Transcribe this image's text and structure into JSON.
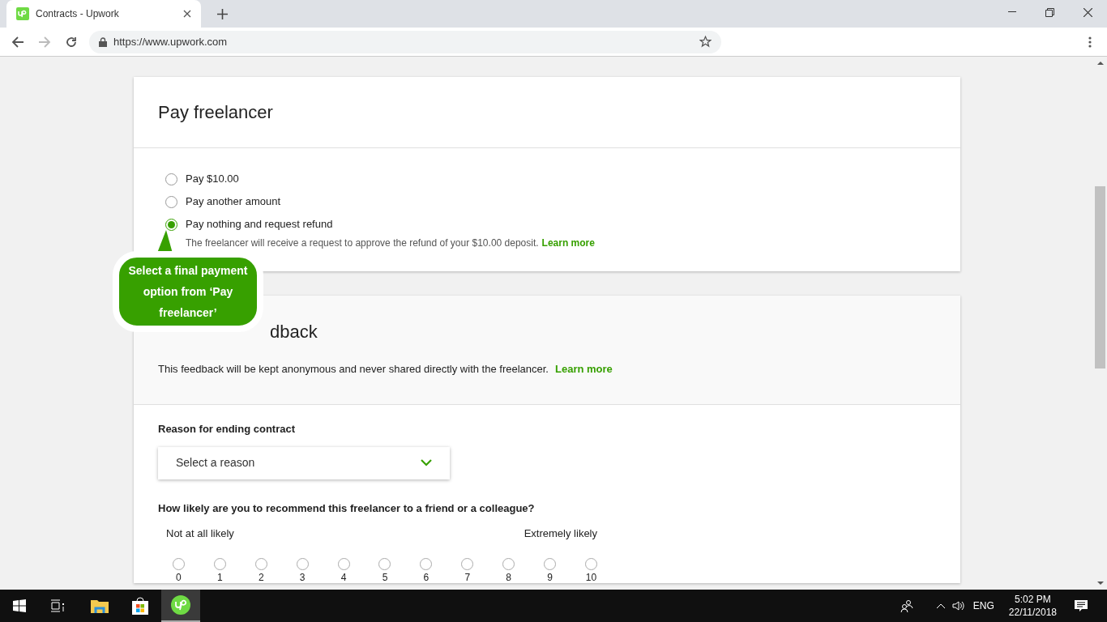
{
  "browser": {
    "tab_title": "Contracts - Upwork",
    "url": "https://www.upwork.com"
  },
  "pay_card": {
    "title": "Pay freelancer",
    "options": [
      {
        "label": "Pay $10.00",
        "selected": false
      },
      {
        "label": "Pay another amount",
        "selected": false
      },
      {
        "label": "Pay nothing and request refund",
        "selected": true
      }
    ],
    "note": "The freelancer will receive a request to approve the refund of your $10.00 deposit.",
    "note_link": "Learn more"
  },
  "tooltip": "Select a final payment option from ‘Pay freelancer’",
  "feedback_card": {
    "title": "dback",
    "intro": "This feedback will be kept anonymous and never shared directly with the freelancer.",
    "intro_link": "Learn more",
    "reason_label": "Reason for ending contract",
    "reason_select": {
      "placeholder": "Select a reason"
    },
    "question": "How likely are you to recommend this freelancer to a friend or a colleague?",
    "low_label": "Not at all likely",
    "high_label": "Extremely likely",
    "scale": [
      {
        "label": "0",
        "selected": false
      },
      {
        "label": "1",
        "selected": false
      },
      {
        "label": "2",
        "selected": false
      },
      {
        "label": "3",
        "selected": false
      },
      {
        "label": "4",
        "selected": false
      },
      {
        "label": "5",
        "selected": false
      },
      {
        "label": "6",
        "selected": false
      },
      {
        "label": "7",
        "selected": false
      },
      {
        "label": "8",
        "selected": false
      },
      {
        "label": "9",
        "selected": false
      },
      {
        "label": "10",
        "selected": false
      }
    ]
  },
  "taskbar": {
    "language": "ENG",
    "time": "5:02 PM",
    "date": "22/11/2018"
  }
}
